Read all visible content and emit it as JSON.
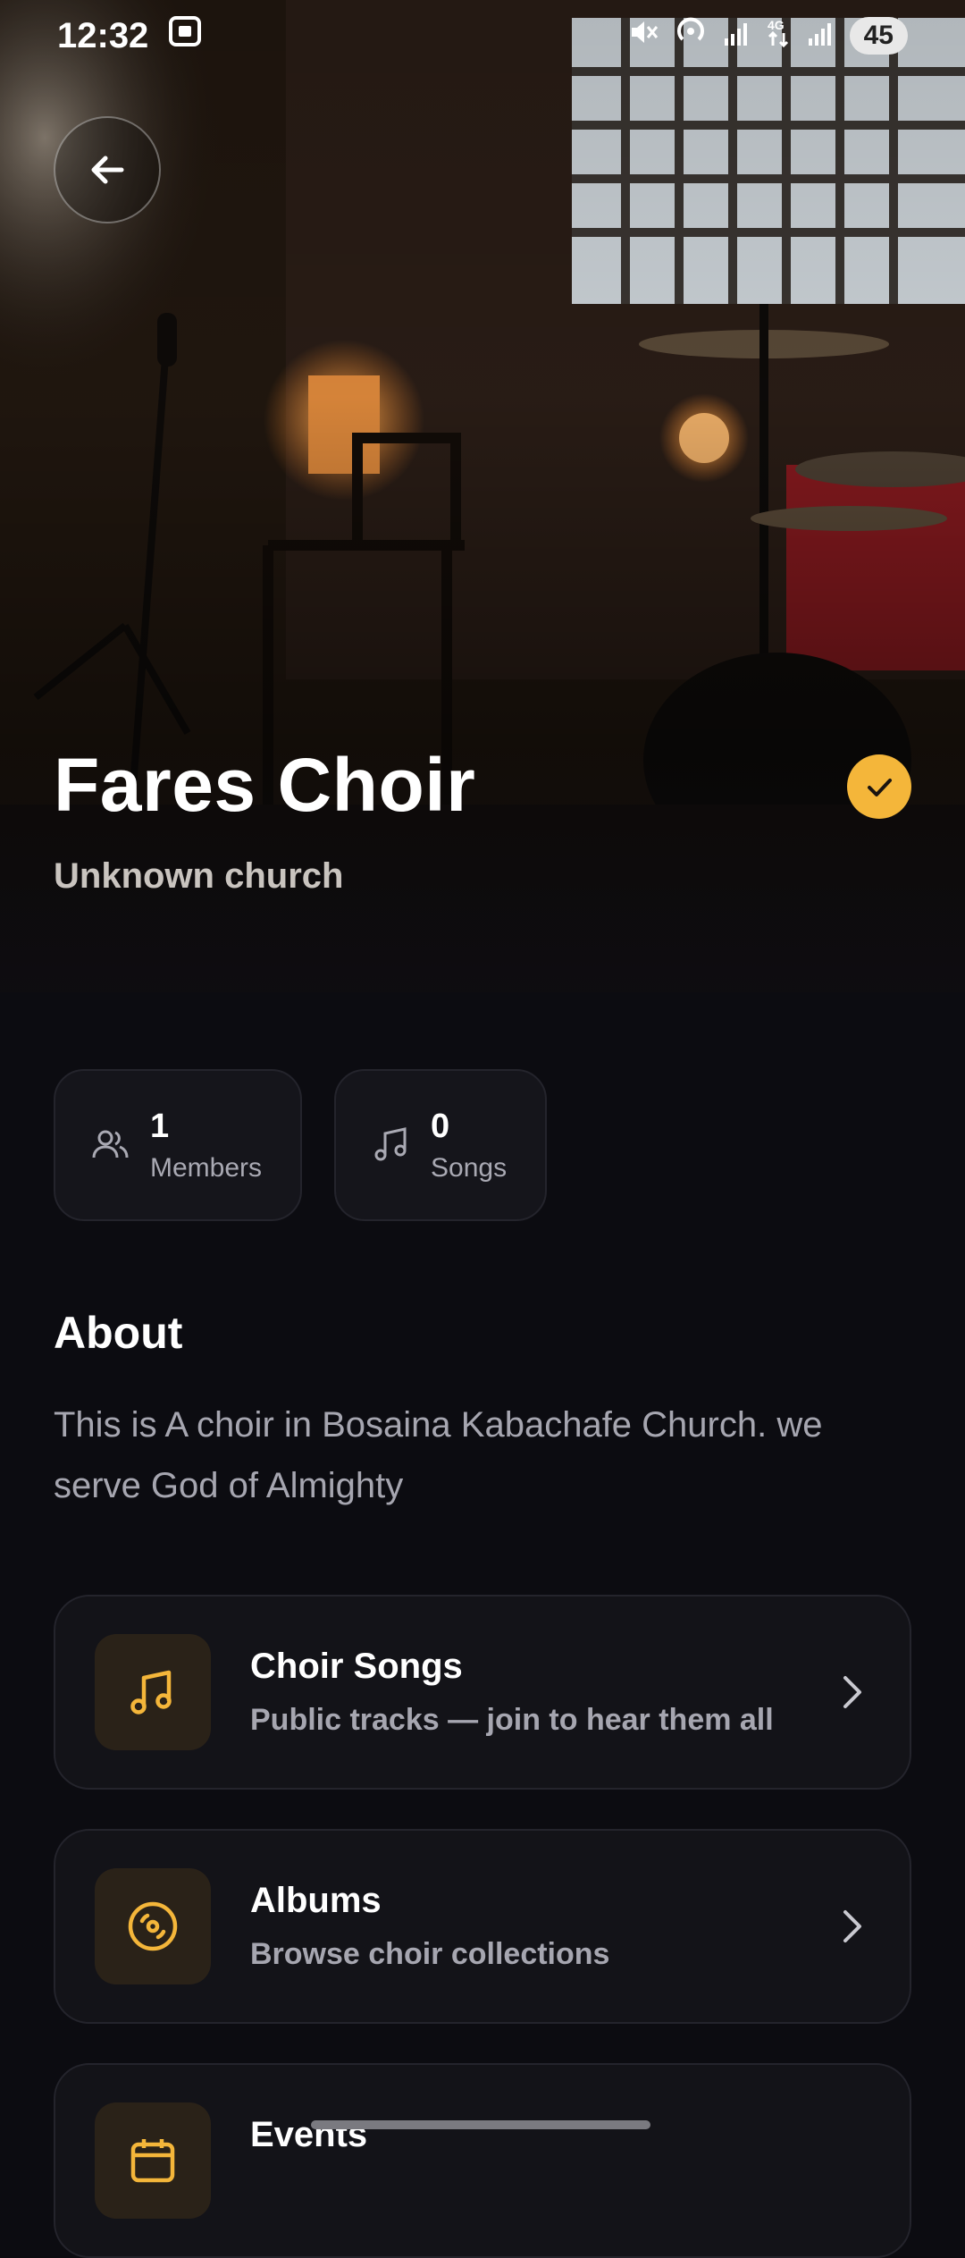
{
  "status_bar": {
    "time": "12:32",
    "battery": "45"
  },
  "hero": {
    "title": "Fares Choir",
    "subtitle": "Unknown church"
  },
  "stats": [
    {
      "value": "1",
      "label": "Members",
      "icon": "people-icon"
    },
    {
      "value": "0",
      "label": "Songs",
      "icon": "music-note-icon"
    }
  ],
  "about": {
    "title": "About",
    "text": "This is A choir in Bosaina Kabachafe Church. we serve God of Almighty"
  },
  "cards": [
    {
      "title": "Choir Songs",
      "subtitle": "Public tracks — join to hear them all",
      "icon": "music-note-icon"
    },
    {
      "title": "Albums",
      "subtitle": "Browse choir collections",
      "icon": "disc-icon"
    },
    {
      "title": "Events",
      "subtitle": "",
      "icon": "calendar-icon"
    }
  ],
  "colors": {
    "accent": "#f4b63a",
    "background": "#0c0c11",
    "card": "#131318"
  }
}
